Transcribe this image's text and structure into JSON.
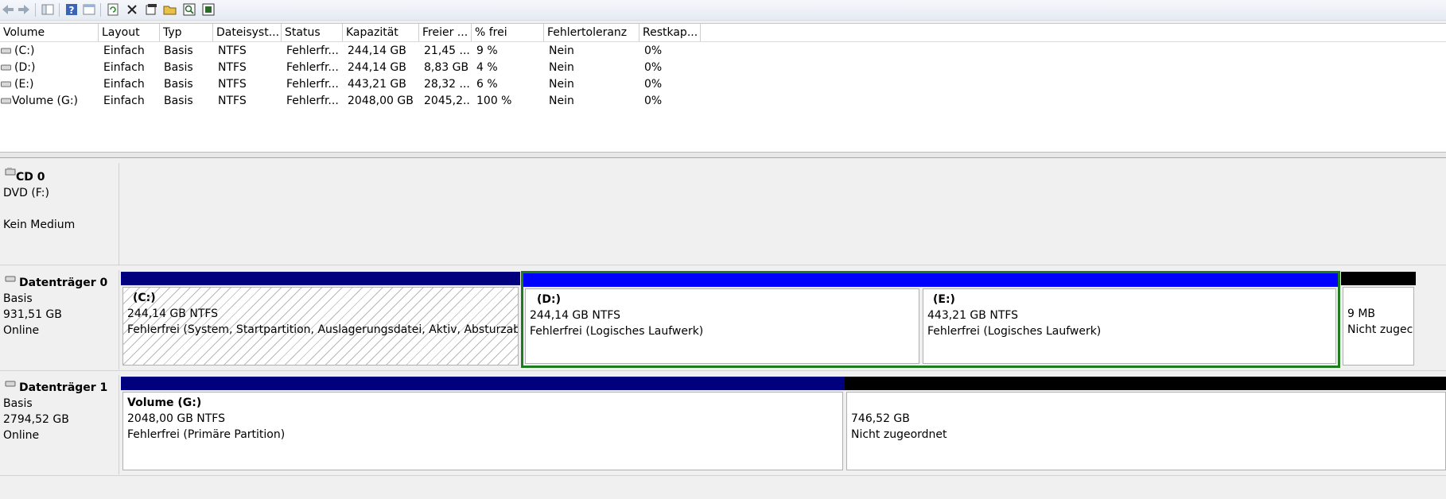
{
  "toolbar": {
    "icons": [
      "back-arrow-icon",
      "forward-arrow-icon",
      "console-tree-icon",
      "help-icon",
      "window-icon",
      "refresh-icon",
      "delete-icon",
      "properties-icon",
      "open-folder-icon",
      "explore-icon",
      "rescan-icon"
    ]
  },
  "volume_list": {
    "columns": [
      "Volume",
      "Layout",
      "Typ",
      "Dateisyst...",
      "Status",
      "Kapazität",
      "Freier ...",
      "% frei",
      "Fehlertoleranz",
      "Restkap..."
    ],
    "rows": [
      {
        "volume": "(C:)",
        "layout": "Einfach",
        "typ": "Basis",
        "fs": "NTFS",
        "status": "Fehlerfr...",
        "kapazitaet": "244,14 GB",
        "frei": "21,45 ...",
        "pct": "9 %",
        "fehlertoleranz": "Nein",
        "restkap": "0%"
      },
      {
        "volume": "(D:)",
        "layout": "Einfach",
        "typ": "Basis",
        "fs": "NTFS",
        "status": "Fehlerfr...",
        "kapazitaet": "244,14 GB",
        "frei": "8,83 GB",
        "pct": "4 %",
        "fehlertoleranz": "Nein",
        "restkap": "0%"
      },
      {
        "volume": "(E:)",
        "layout": "Einfach",
        "typ": "Basis",
        "fs": "NTFS",
        "status": "Fehlerfr...",
        "kapazitaet": "443,21 GB",
        "frei": "28,32 ...",
        "pct": "6 %",
        "fehlertoleranz": "Nein",
        "restkap": "0%"
      },
      {
        "volume": "Volume (G:)",
        "layout": "Einfach",
        "typ": "Basis",
        "fs": "NTFS",
        "status": "Fehlerfr...",
        "kapazitaet": "2048,00 GB",
        "frei": "2045,2...",
        "pct": "100 %",
        "fehlertoleranz": "Nein",
        "restkap": "0%"
      }
    ]
  },
  "disks": {
    "cd0": {
      "name": "CD 0",
      "type": "DVD (F:)",
      "state": "Kein Medium"
    },
    "disk0": {
      "name": "Datenträger 0",
      "type": "Basis",
      "size": "931,51 GB",
      "status": "Online",
      "partitions": [
        {
          "title": "(C:)",
          "size": "244,14 GB NTFS",
          "status": "Fehlerfrei (System, Startpartition, Auslagerungsdatei, Aktiv, Absturzabbild,"
        },
        {
          "title": "(D:)",
          "size": "244,14 GB NTFS",
          "status": "Fehlerfrei (Logisches Laufwerk)"
        },
        {
          "title": "(E:)",
          "size": "443,21 GB NTFS",
          "status": "Fehlerfrei (Logisches Laufwerk)"
        },
        {
          "size": "9 MB",
          "status": "Nicht zugec"
        }
      ]
    },
    "disk1": {
      "name": "Datenträger 1",
      "type": "Basis",
      "size": "2794,52 GB",
      "status": "Online",
      "partitions": [
        {
          "title": "Volume  (G:)",
          "size": "2048,00 GB NTFS",
          "status": "Fehlerfrei (Primäre Partition)"
        },
        {
          "size": "746,52 GB",
          "status": "Nicht zugeordnet"
        }
      ]
    }
  },
  "colors": {
    "primary_bar": "#00007e",
    "logical_bar": "#0000ff",
    "unallocated_bar": "#000000",
    "selection": "#1e7b1e"
  }
}
